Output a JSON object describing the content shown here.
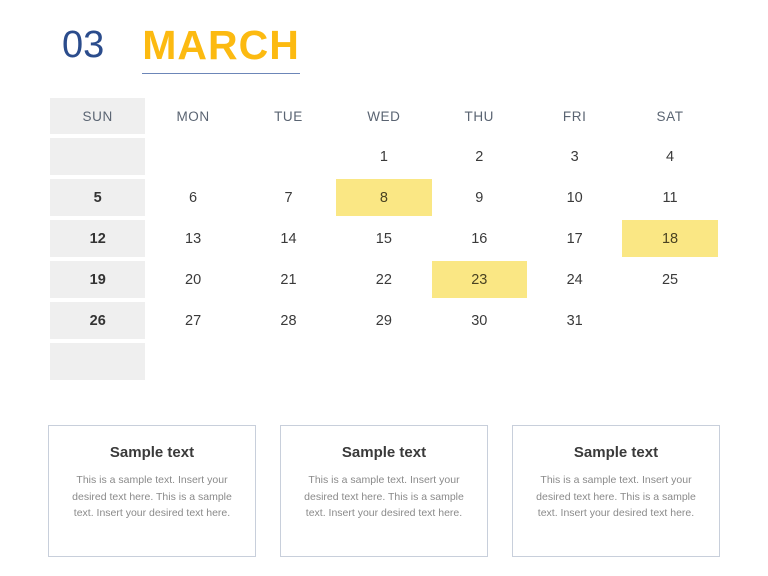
{
  "header": {
    "month_number": "03",
    "month_name": "MARCH",
    "number_color": "#2B4C8C",
    "name_color": "#FCBA11",
    "rule_color": "#6C86B8"
  },
  "calendar": {
    "weekday_headers": [
      "SUN",
      "MON",
      "TUE",
      "WED",
      "THU",
      "FRI",
      "SAT"
    ],
    "sunday_column_bg": "#EFEFEF",
    "highlight_bg": "#FAE784",
    "weeks": [
      {
        "days": [
          {
            "label": "",
            "highlight": false
          },
          {
            "label": "",
            "highlight": false
          },
          {
            "label": "",
            "highlight": false
          },
          {
            "label": "1",
            "highlight": false
          },
          {
            "label": "2",
            "highlight": false
          },
          {
            "label": "3",
            "highlight": false
          },
          {
            "label": "4",
            "highlight": false
          }
        ]
      },
      {
        "days": [
          {
            "label": "5",
            "highlight": false
          },
          {
            "label": "6",
            "highlight": false
          },
          {
            "label": "7",
            "highlight": false
          },
          {
            "label": "8",
            "highlight": true
          },
          {
            "label": "9",
            "highlight": false
          },
          {
            "label": "10",
            "highlight": false
          },
          {
            "label": "11",
            "highlight": false
          }
        ]
      },
      {
        "days": [
          {
            "label": "12",
            "highlight": false
          },
          {
            "label": "13",
            "highlight": false
          },
          {
            "label": "14",
            "highlight": false
          },
          {
            "label": "15",
            "highlight": false
          },
          {
            "label": "16",
            "highlight": false
          },
          {
            "label": "17",
            "highlight": false
          },
          {
            "label": "18",
            "highlight": true
          }
        ]
      },
      {
        "days": [
          {
            "label": "19",
            "highlight": false
          },
          {
            "label": "20",
            "highlight": false
          },
          {
            "label": "21",
            "highlight": false
          },
          {
            "label": "22",
            "highlight": false
          },
          {
            "label": "23",
            "highlight": true
          },
          {
            "label": "24",
            "highlight": false
          },
          {
            "label": "25",
            "highlight": false
          }
        ]
      },
      {
        "days": [
          {
            "label": "26",
            "highlight": false
          },
          {
            "label": "27",
            "highlight": false
          },
          {
            "label": "28",
            "highlight": false
          },
          {
            "label": "29",
            "highlight": false
          },
          {
            "label": "30",
            "highlight": false
          },
          {
            "label": "31",
            "highlight": false
          },
          {
            "label": "",
            "highlight": false
          }
        ]
      },
      {
        "days": [
          {
            "label": "",
            "highlight": false
          },
          {
            "label": "",
            "highlight": false
          },
          {
            "label": "",
            "highlight": false
          },
          {
            "label": "",
            "highlight": false
          },
          {
            "label": "",
            "highlight": false
          },
          {
            "label": "",
            "highlight": false
          },
          {
            "label": "",
            "highlight": false
          }
        ]
      }
    ]
  },
  "cards": [
    {
      "title": "Sample text",
      "body": "This is a sample text. Insert your desired text here. This is a sample text. Insert your desired text here."
    },
    {
      "title": "Sample text",
      "body": "This is a sample text. Insert your desired text here. This is a sample text. Insert your desired text here."
    },
    {
      "title": "Sample text",
      "body": "This is a sample text. Insert your desired text here. This is a sample text. Insert your desired text here."
    }
  ]
}
